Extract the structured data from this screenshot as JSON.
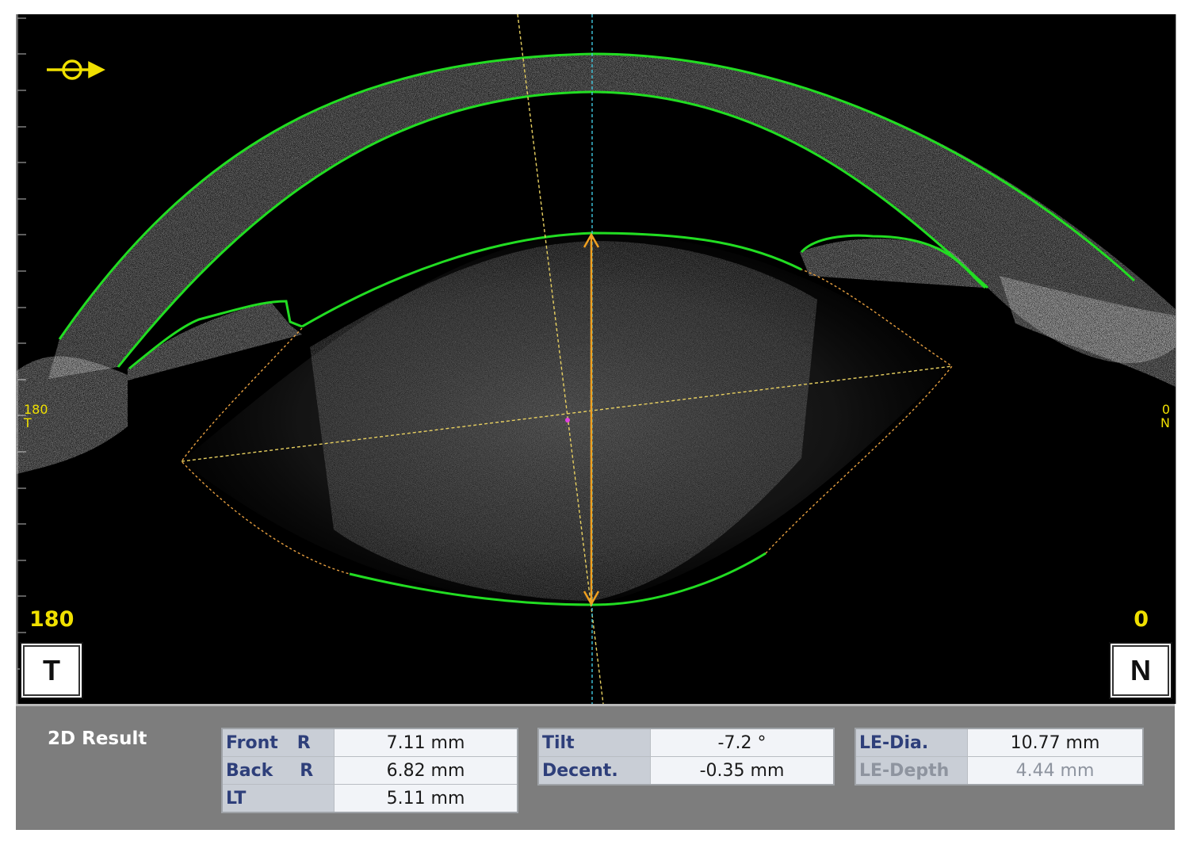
{
  "scan": {
    "left_marker_value": "180",
    "left_marker_letter": "T",
    "right_marker_value": "0",
    "right_marker_letter": "N",
    "left_small_value": "180",
    "left_small_letter": "T",
    "right_small_value": "0",
    "right_small_letter": "N",
    "icon": "eye-direction-icon",
    "colors": {
      "background": "#000000",
      "contour": "#22dd22",
      "axis_marker": "#f0e000",
      "measure_arrow": "#f0a020",
      "guide_line": "#e8d060",
      "center_line": "#40c8e0",
      "lens_boundary": "#e8a040",
      "center_point": "#e040e0"
    }
  },
  "results": {
    "title": "2D Result",
    "table1": [
      {
        "label": "Front",
        "sub": "R",
        "value": "7.11 mm"
      },
      {
        "label": "Back",
        "sub": "R",
        "value": "6.82 mm"
      },
      {
        "label": "LT",
        "sub": "",
        "value": "5.11 mm"
      }
    ],
    "table2": [
      {
        "label": "Tilt",
        "value": "-7.2 °"
      },
      {
        "label": "Decent.",
        "value": "-0.35 mm"
      }
    ],
    "table3": [
      {
        "label": "LE-Dia.",
        "value": "10.77 mm"
      },
      {
        "label": "LE-Depth",
        "value": "4.44 mm"
      }
    ]
  }
}
